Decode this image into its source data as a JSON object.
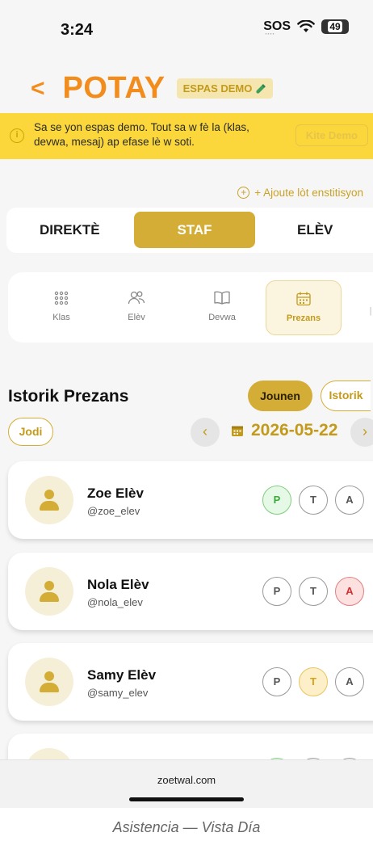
{
  "status_bar": {
    "time": "3:24",
    "sos": "SOS",
    "battery": "49"
  },
  "header": {
    "back_icon": "chevron-left-icon",
    "brand": "POTAY",
    "demo_badge": "ESPAS DEMO"
  },
  "banner": {
    "text": "Sa se yon espas demo. Tout sa w fè la (klas, devwa, mesaj) ap efase lè w soti.",
    "button": "Kite Demo"
  },
  "add_institution": "+ Ajoute lòt enstitisyon",
  "roles": [
    {
      "label": "DIREKTÈ",
      "active": false
    },
    {
      "label": "STAF",
      "active": true
    },
    {
      "label": "ELÈV",
      "active": false
    }
  ],
  "modules": [
    {
      "label": "Klas",
      "icon": "grid-icon"
    },
    {
      "label": "Elèv",
      "icon": "users-icon"
    },
    {
      "label": "Devwa",
      "icon": "book-icon"
    },
    {
      "label": "Prezans",
      "icon": "calendar-icon",
      "active": true
    }
  ],
  "history": {
    "title": "Istorik Prezans",
    "view_day": "Jounen",
    "view_history": "Istorik",
    "today_button": "Jodi",
    "date": "2026-05-22"
  },
  "students": [
    {
      "name": "Zoe Elèv",
      "handle": "@zoe_elev",
      "status": "P"
    },
    {
      "name": "Nola Elèv",
      "handle": "@nola_elev",
      "status": "A"
    },
    {
      "name": "Samy Elèv",
      "handle": "@samy_elev",
      "status": "T"
    }
  ],
  "attendance_options": {
    "present": "P",
    "tardy": "T",
    "absent": "A"
  },
  "browser": {
    "url": "zoetwal.com"
  },
  "caption": "Asistencia — Vista Día",
  "colors": {
    "accent": "#d4ad36",
    "brand": "#f28c1c",
    "banner": "#fbd73b"
  }
}
